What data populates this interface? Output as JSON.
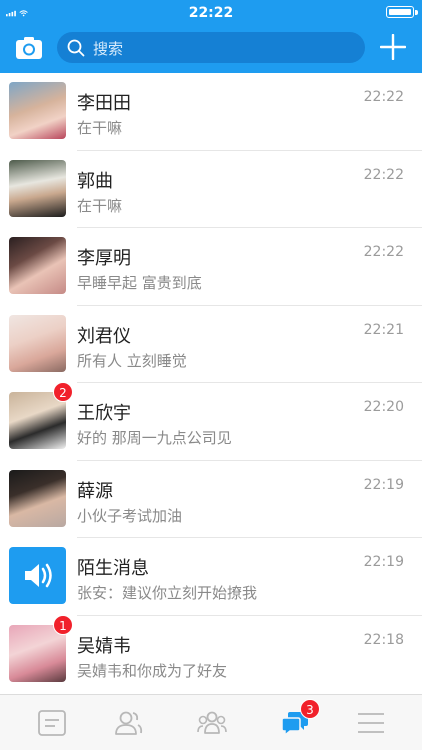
{
  "status_bar": {
    "time": "22:22"
  },
  "header": {
    "search_placeholder": "搜索"
  },
  "colors": {
    "accent": "#1e9cf0",
    "badge": "#f1212b"
  },
  "conversations": [
    {
      "name": "李田田",
      "message": "在干嘛",
      "time": "22:22",
      "badge": ""
    },
    {
      "name": "郭曲",
      "message": "在干嘛",
      "time": "22:22",
      "badge": ""
    },
    {
      "name": "李厚明",
      "message": "早睡早起 富贵到底",
      "time": "22:22",
      "badge": ""
    },
    {
      "name": "刘君仪",
      "message": "所有人 立刻睡觉",
      "time": "22:21",
      "badge": ""
    },
    {
      "name": "王欣宇",
      "message": "好的 那周一九点公司见",
      "time": "22:20",
      "badge": "2"
    },
    {
      "name": "薛源",
      "message": "小伙子考试加油",
      "time": "22:19",
      "badge": ""
    },
    {
      "name": "陌生消息",
      "message": "张安：建议你立刻开始撩我",
      "time": "22:19",
      "badge": ""
    },
    {
      "name": "吴婧韦",
      "message": "吴婧韦和你成为了好友",
      "time": "22:18",
      "badge": "1"
    }
  ],
  "tabbar": {
    "tabs": [
      {
        "icon": "notes-icon",
        "active": false
      },
      {
        "icon": "contacts-icon",
        "active": false
      },
      {
        "icon": "groups-icon",
        "active": false
      },
      {
        "icon": "messages-icon",
        "active": true,
        "badge": "3"
      },
      {
        "icon": "menu-icon",
        "active": false
      }
    ]
  }
}
